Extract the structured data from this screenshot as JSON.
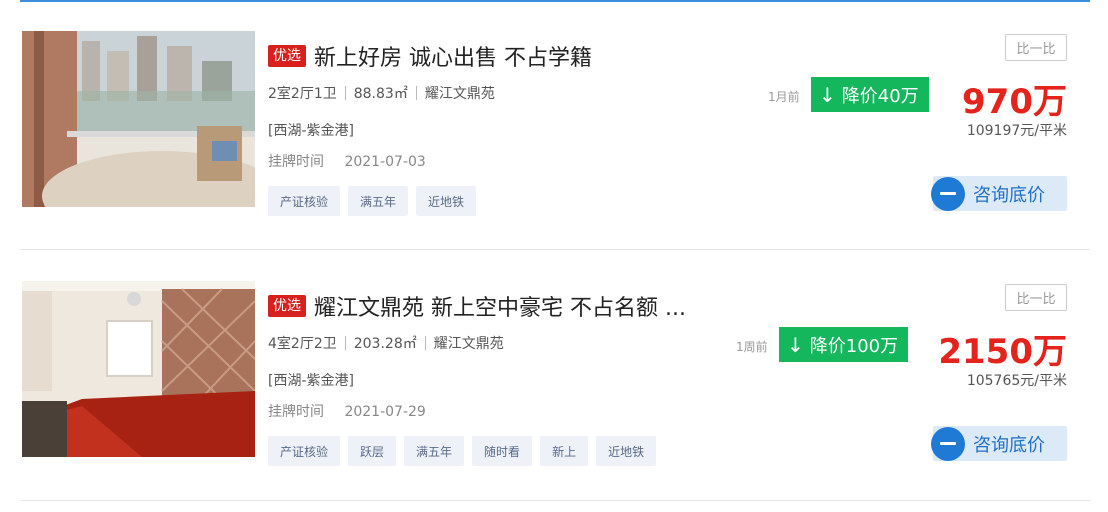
{
  "listings": [
    {
      "badge": "优选",
      "title": "新上好房 诚心出售 不占学籍",
      "layout": "2室2厅1卫",
      "area": "88.83㎡",
      "community": "耀江文鼎苑",
      "district": "[西湖-紫金港]",
      "listed_label": "挂牌时间",
      "listed_date": "2021-07-03",
      "tags": [
        "产证核验",
        "满五年",
        "近地铁"
      ],
      "compare_label": "比一比",
      "drop_ago": "1月前",
      "drop_label": "降价40万",
      "price": "970万",
      "unit_price": "109197元/平米",
      "consult_label": "咨询底价"
    },
    {
      "badge": "优选",
      "title": "耀江文鼎苑 新上空中豪宅 不占名额 ...",
      "layout": "4室2厅2卫",
      "area": "203.28㎡",
      "community": "耀江文鼎苑",
      "district": "[西湖-紫金港]",
      "listed_label": "挂牌时间",
      "listed_date": "2021-07-29",
      "tags": [
        "产证核验",
        "跃层",
        "满五年",
        "随时看",
        "新上",
        "近地铁"
      ],
      "compare_label": "比一比",
      "drop_ago": "1周前",
      "drop_label": "降价100万",
      "price": "2150万",
      "unit_price": "105765元/平米",
      "consult_label": "咨询底价"
    }
  ],
  "icons": {
    "drop_arrow": "down-arrow-icon",
    "consult": "chat-bubble-icon"
  },
  "colors": {
    "badge": "#d7211e",
    "price": "#e3231c",
    "drop": "#14b75c",
    "consult_bg": "#dceaf8",
    "consult_icon": "#1f7ad6"
  }
}
